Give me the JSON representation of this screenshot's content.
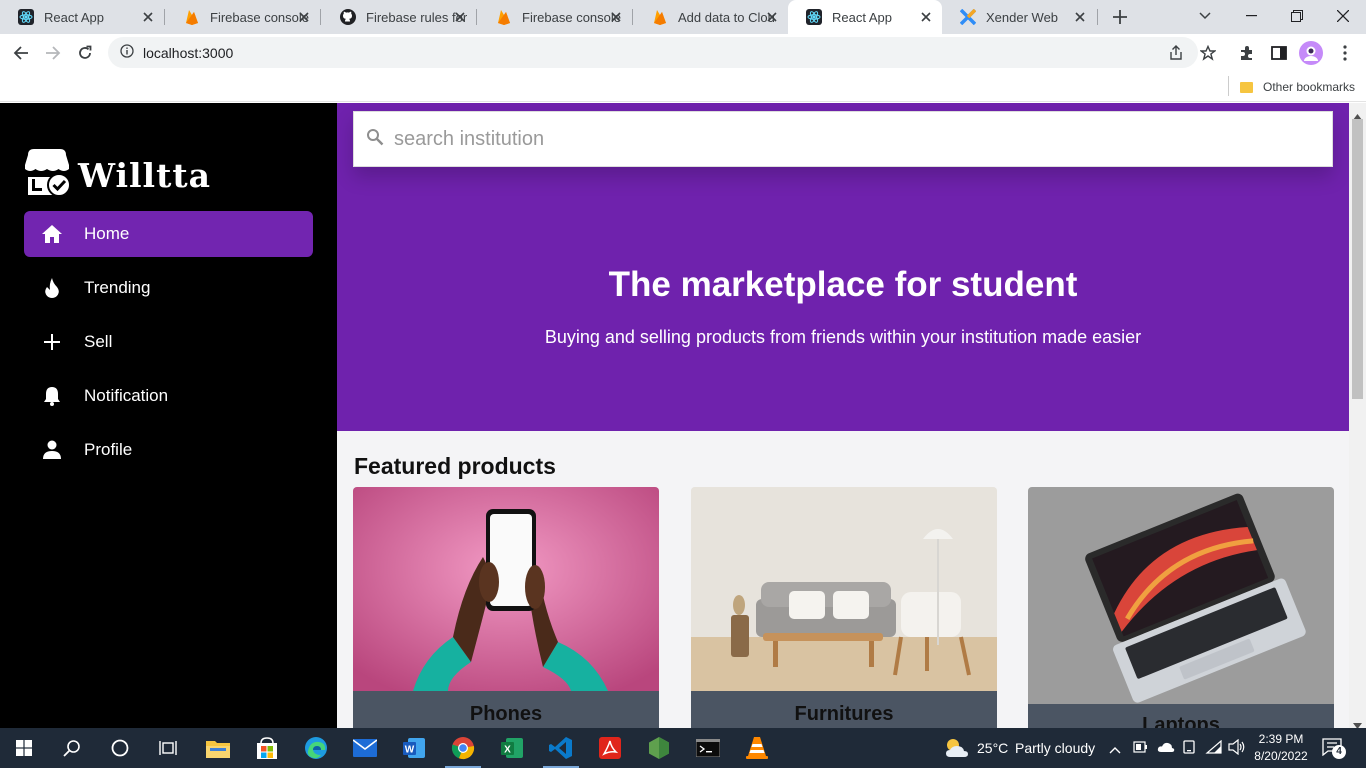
{
  "browser": {
    "tabs": [
      {
        "title": "React App",
        "icon": "react-icon",
        "active": false
      },
      {
        "title": "Firebase console",
        "icon": "firebase-icon",
        "active": false
      },
      {
        "title": "Firebase rules for",
        "icon": "github-icon",
        "active": false
      },
      {
        "title": "Firebase console",
        "icon": "firebase-icon",
        "active": false
      },
      {
        "title": "Add data to Clou",
        "icon": "firebase-icon",
        "active": false
      },
      {
        "title": "React App",
        "icon": "react-icon",
        "active": true
      },
      {
        "title": "Xender Web",
        "icon": "xender-icon",
        "active": false
      }
    ],
    "url": "localhost:3000",
    "bookmark": "Other bookmarks"
  },
  "sidebar": {
    "logo_text": "Willtta",
    "items": [
      {
        "label": "Home",
        "icon": "home-icon",
        "active": true
      },
      {
        "label": "Trending",
        "icon": "flame-icon",
        "active": false
      },
      {
        "label": "Sell",
        "icon": "plus-icon",
        "active": false
      },
      {
        "label": "Notification",
        "icon": "bell-icon",
        "active": false
      },
      {
        "label": "Profile",
        "icon": "person-icon",
        "active": false
      }
    ]
  },
  "main": {
    "search_placeholder": "search institution",
    "hero_title": "The marketplace for student",
    "hero_subtitle": "Buying and selling products from friends within your institution made easier",
    "featured_title": "Featured products",
    "products": [
      {
        "label": "Phones"
      },
      {
        "label": "Furnitures"
      },
      {
        "label": "Laptops"
      }
    ]
  },
  "taskbar": {
    "weather_temp": "25°C",
    "weather_text": "Partly cloudy",
    "time": "2:39 PM",
    "date": "8/20/2022",
    "notification_count": "4"
  },
  "colors": {
    "accent": "#7225b0",
    "hero": "#6f22ad",
    "sidebar": "#000000"
  }
}
